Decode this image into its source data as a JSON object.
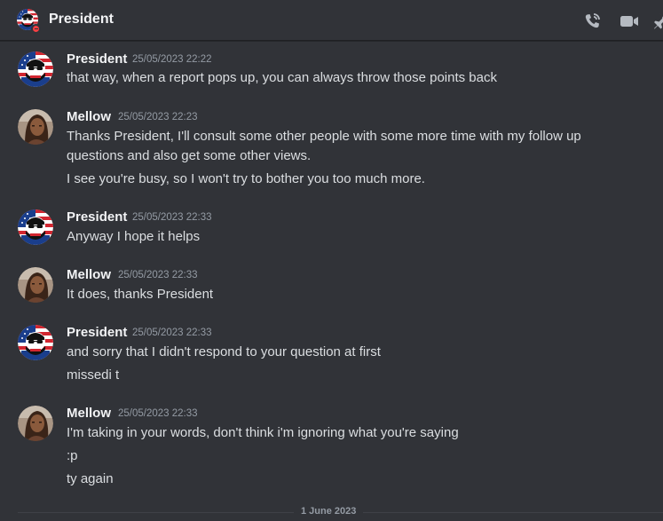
{
  "header": {
    "title": "President",
    "icons": [
      "flag-avatar-icon",
      "phone-call-icon",
      "video-call-icon",
      "pin-icon"
    ],
    "status_color": "#f23f43"
  },
  "messages": [
    {
      "author": "President",
      "avatar": "president-flag-avatar",
      "timestamp": "25/05/2023 22:22",
      "lines": [
        "that way, when a report pops up, you can always throw those points back"
      ]
    },
    {
      "author": "Mellow",
      "avatar": "mellow-photo-avatar",
      "timestamp": "25/05/2023 22:23",
      "lines": [
        "Thanks President, I'll consult some other people with some more time with my follow up",
        "questions and also get some other views.",
        "I see you're busy, so I won't try to bother you too much more."
      ]
    },
    {
      "author": "President",
      "avatar": "president-flag-avatar",
      "timestamp": "25/05/2023 22:33",
      "lines": [
        "Anyway I hope it helps"
      ]
    },
    {
      "author": "Mellow",
      "avatar": "mellow-photo-avatar",
      "timestamp": "25/05/2023 22:33",
      "lines": [
        "It does, thanks President"
      ]
    },
    {
      "author": "President",
      "avatar": "president-flag-avatar",
      "timestamp": "25/05/2023 22:33",
      "lines": [
        "and sorry that I didn't respond to your question at first",
        "missedi t"
      ]
    },
    {
      "author": "Mellow",
      "avatar": "mellow-photo-avatar",
      "timestamp": "25/05/2023 22:33",
      "lines": [
        "I'm taking in your words, don't think i'm ignoring what you're saying",
        ":p",
        "ty again"
      ]
    }
  ],
  "date_divider": "1 June 2023",
  "colors": {
    "background": "#313338",
    "author": "#f2f3f5",
    "text": "#dbdee1",
    "timestamp": "#949ba4"
  }
}
